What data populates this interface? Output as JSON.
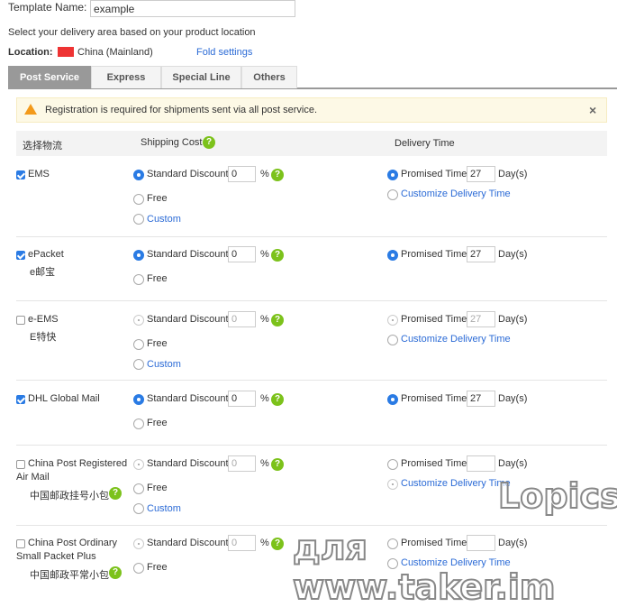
{
  "template": {
    "label": "Template Name:",
    "value": "example"
  },
  "instruction": "Select your delivery area based on your product location",
  "location": {
    "label": "Location:",
    "value": "China (Mainland)",
    "fold": "Fold settings"
  },
  "tabs": [
    "Post Service",
    "Express",
    "Special Line",
    "Others"
  ],
  "warning": "Registration is required for shipments sent via all post service.",
  "headers": {
    "logistics": "选择物流",
    "cost": "Shipping Cost",
    "time": "Delivery Time"
  },
  "labels": {
    "standard": "Standard Discount",
    "percent": "%",
    "free": "Free",
    "custom": "Custom",
    "promised": "Promised Time",
    "days": "Day(s)",
    "customize": "Customize Delivery Time",
    "q": "?"
  },
  "rows": [
    {
      "name": "EMS",
      "sub": "",
      "checked": true,
      "discount": "0",
      "days": "27"
    },
    {
      "name": "ePacket",
      "sub": "e邮宝",
      "checked": true,
      "discount": "0",
      "days": "27"
    },
    {
      "name": "e-EMS",
      "sub": "E特快",
      "checked": false,
      "discount": "0",
      "days": "27"
    },
    {
      "name": "DHL Global Mail",
      "sub": "",
      "checked": true,
      "discount": "0",
      "days": "27"
    },
    {
      "name": "China Post Registered",
      "name2": "Air Mail",
      "sub": "中国邮政挂号小包",
      "checked": false,
      "discount": "0",
      "days": ""
    },
    {
      "name": "China Post Ordinary",
      "name2": "Small Packet Plus",
      "sub": "中国邮政平常小包+",
      "checked": false,
      "discount": "0",
      "days": ""
    }
  ],
  "watermark": {
    "line1": "Lopics",
    "line2": "для www.taker.im"
  }
}
